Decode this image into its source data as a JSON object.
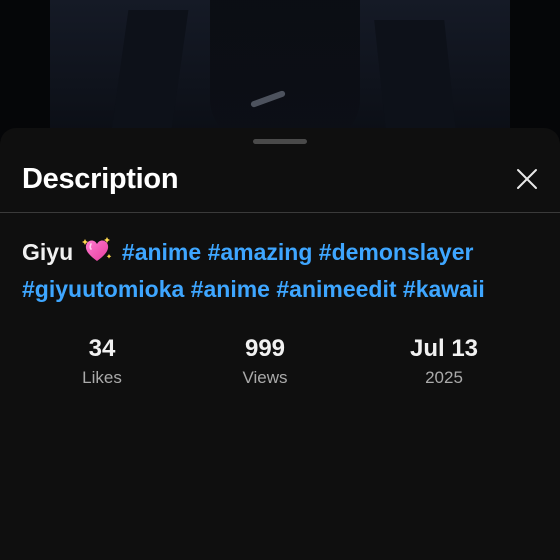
{
  "sheet": {
    "title": "Description",
    "close_icon": "close-icon"
  },
  "description": {
    "text": "Giyu",
    "emoji_icon": "sparkling-heart-icon",
    "hashtags": [
      "#anime",
      "#amazing",
      "#demonslayer",
      "#giyuutomioka",
      "#anime",
      "#animeedit",
      "#kawaii"
    ]
  },
  "stats": {
    "likes": {
      "value": "34",
      "label": "Likes"
    },
    "views": {
      "value": "999",
      "label": "Views"
    },
    "date": {
      "value": "Jul 13",
      "label": "2025"
    }
  },
  "colors": {
    "sheet_bg": "#0f0f0f",
    "hashtag": "#3ea6ff",
    "label": "#aaaaaa",
    "divider": "#3a3a3a"
  }
}
